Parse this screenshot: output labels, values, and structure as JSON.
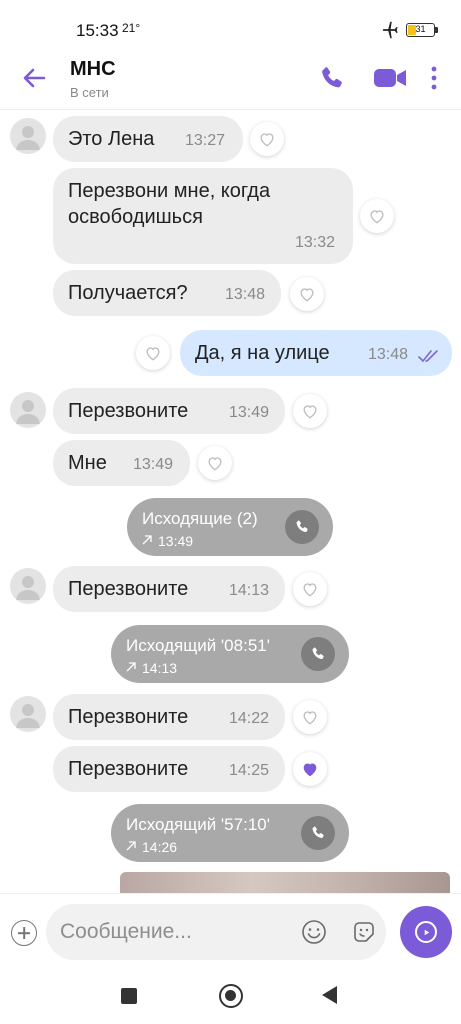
{
  "status_bar": {
    "time": "15:33",
    "temperature": "21°",
    "battery": "31"
  },
  "header": {
    "contact_name": "МНС",
    "contact_status": "В сети"
  },
  "messages": [
    {
      "text": "Это Лена",
      "time": "13:27"
    },
    {
      "text_line1": "Перезвони мне,  когда",
      "text_line2": "освободишься",
      "time": "13:32"
    },
    {
      "text": "Получается?",
      "time": "13:48"
    },
    {
      "text": "Да, я на улице",
      "time": "13:48"
    },
    {
      "text": "Перезвоните",
      "time": "13:49"
    },
    {
      "text": "Мне",
      "time": "13:49"
    },
    {
      "title": "Исходящие (2)",
      "time": "13:49"
    },
    {
      "text": "Перезвоните",
      "time": "14:13"
    },
    {
      "title": "Исходящий '08:51'",
      "time": "14:13"
    },
    {
      "text": "Перезвоните",
      "time": "14:22"
    },
    {
      "text": "Перезвоните",
      "time": "14:25"
    },
    {
      "title": "Исходящий '57:10'",
      "time": "14:26"
    }
  ],
  "composer": {
    "placeholder": "Сообщение..."
  },
  "colors": {
    "accent": "#7b5bd8",
    "incoming_bubble": "#ececec",
    "outgoing_bubble": "#d6e8ff",
    "call_pill": "#a9a9a9",
    "battery": "#f2c318"
  },
  "icons": {
    "status": [
      "airplane-icon",
      "battery-icon"
    ],
    "header": [
      "back-arrow-icon",
      "phone-icon",
      "video-camera-icon",
      "more-vertical-icon"
    ],
    "message": [
      "heart-icon",
      "heart-filled-icon",
      "double-check-icon",
      "outgoing-arrow-icon",
      "call-phone-icon"
    ],
    "composer": [
      "plus-icon",
      "emoji-icon",
      "sticker-icon",
      "send-icon"
    ],
    "nav": [
      "recents-icon",
      "home-icon",
      "back-icon"
    ]
  }
}
